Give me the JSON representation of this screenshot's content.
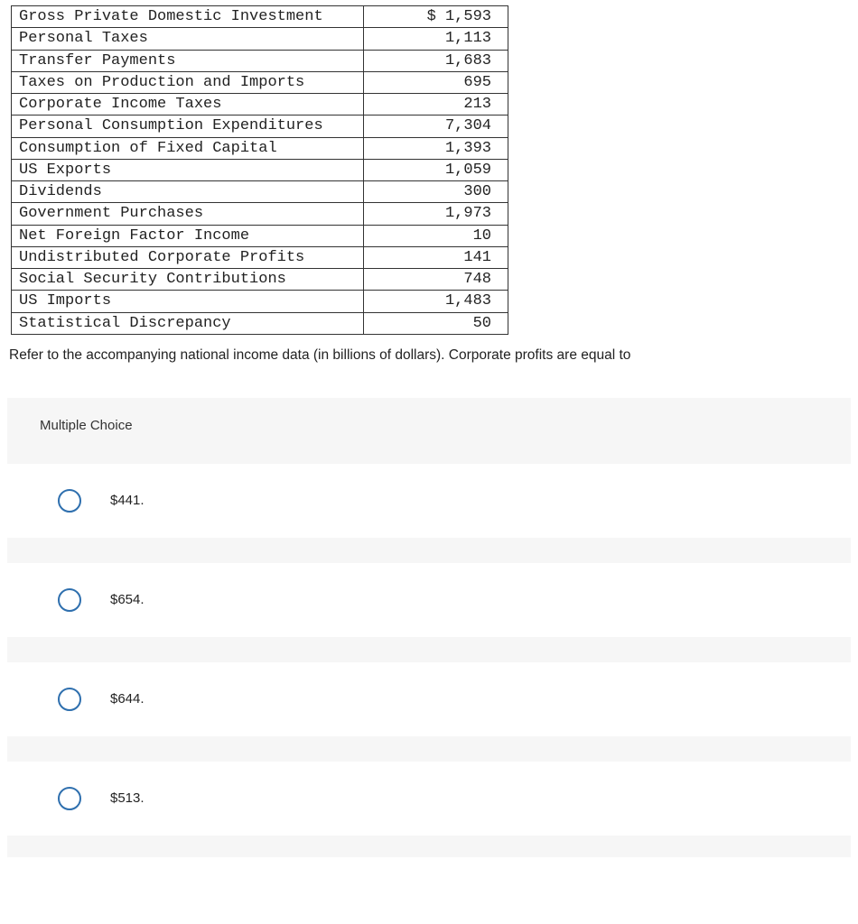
{
  "table": {
    "rows": [
      {
        "label": "Gross Private Domestic Investment",
        "value": "$ 1,593"
      },
      {
        "label": "Personal Taxes",
        "value": "1,113"
      },
      {
        "label": "Transfer Payments",
        "value": "1,683"
      },
      {
        "label": "Taxes on Production and Imports",
        "value": "695"
      },
      {
        "label": "Corporate Income Taxes",
        "value": "213"
      },
      {
        "label": "Personal Consumption Expenditures",
        "value": "7,304"
      },
      {
        "label": "Consumption of Fixed Capital",
        "value": "1,393"
      },
      {
        "label": "US Exports",
        "value": "1,059"
      },
      {
        "label": "Dividends",
        "value": "300"
      },
      {
        "label": "Government Purchases",
        "value": "1,973"
      },
      {
        "label": "Net Foreign Factor Income",
        "value": "10"
      },
      {
        "label": "Undistributed Corporate Profits",
        "value": "141"
      },
      {
        "label": "Social Security Contributions",
        "value": "748"
      },
      {
        "label": "US Imports",
        "value": "1,483"
      },
      {
        "label": "Statistical Discrepancy",
        "value": "50"
      }
    ]
  },
  "question_text": "Refer to the accompanying national income data (in billions of dollars). Corporate profits are equal to",
  "mc": {
    "header": "Multiple Choice",
    "choices": [
      {
        "label": "$441."
      },
      {
        "label": "$654."
      },
      {
        "label": "$644."
      },
      {
        "label": "$513."
      }
    ]
  }
}
